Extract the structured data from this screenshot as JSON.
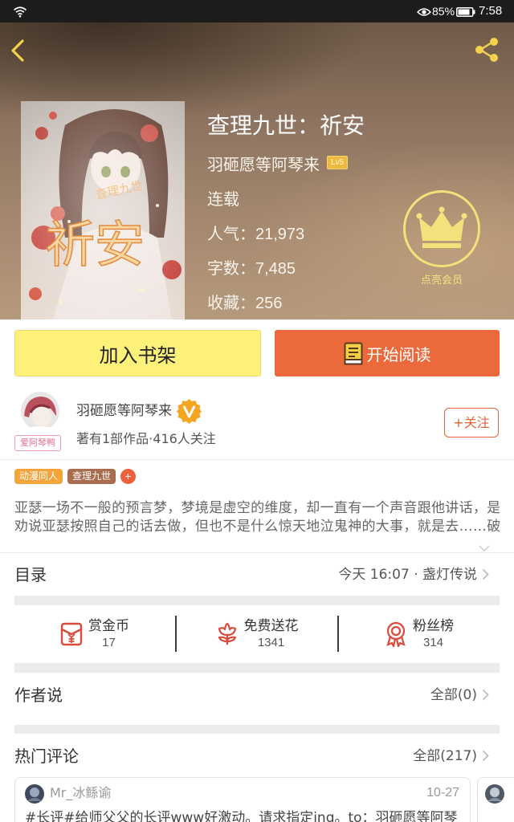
{
  "status_bar": {
    "battery": "85%",
    "battery_level": 0.85,
    "time": "7:58"
  },
  "header": {
    "back_icon": "chevron-left-icon",
    "share_icon": "share-icon"
  },
  "book": {
    "cover": {
      "series_art_text": "查理九世",
      "title_art_text": "祈安"
    },
    "title": "查理九世：祈安",
    "author": "羽砸愿等阿琴来",
    "author_level": "Lv5",
    "status": "连载",
    "stats": [
      {
        "label": "人气：",
        "value": "21,973"
      },
      {
        "label": "字数：",
        "value": "7,485"
      },
      {
        "label": "收藏：",
        "value": "256"
      }
    ]
  },
  "vip": {
    "icon": "crown-icon",
    "label": "点亮会员"
  },
  "actions": {
    "add_to_shelf": "加入书架",
    "start_reading": "开始阅读",
    "start_reading_icon": "book-icon"
  },
  "author_card": {
    "name": "羽砸愿等阿琴来",
    "badge_icon": "verified-v-badge-icon",
    "avatar_tag": "爱阿琴鸭",
    "summary": "著有1部作品·416人关注",
    "follow_label": "+关注"
  },
  "tags": [
    {
      "label": "动漫同人",
      "color": "#f4a43a"
    },
    {
      "label": "查理九世",
      "color": "#a86d4f"
    }
  ],
  "tag_add": {
    "label": "+",
    "color": "#ea613c"
  },
  "description": {
    "lines": [
      "亚瑟一场不一般的预言梦，梦境是虚空的维度，却一直有一个声音跟他讲话，是",
      "劝说亚瑟按照自己的话去做，但也不是什么惊天地泣鬼神的大事，就是去……破"
    ],
    "expand_icon": "chevron-down-icon"
  },
  "catalog": {
    "label": "目录",
    "latest": "今天 16:07 · 盏灯传说"
  },
  "rewards": [
    {
      "label": "赏金币",
      "value": "17",
      "icon": "red-envelope-icon"
    },
    {
      "label": "免费送花",
      "value": "1341",
      "icon": "flower-icon"
    },
    {
      "label": "粉丝榜",
      "value": "314",
      "icon": "award-ribbon-icon"
    }
  ],
  "author_says": {
    "label": "作者说",
    "all": "全部(0)"
  },
  "hot_comments": {
    "label": "热门评论",
    "all": "全部(217)",
    "items": [
      {
        "user": "Mr_冰鲧谕",
        "date": "10-27",
        "text": "#长评#给师父父的长评www好激动。请求指定ing。to：羽砸愿等阿琴"
      }
    ]
  },
  "colors": {
    "accent_orange": "#ea6a3c",
    "shelf_yellow": "#fdf17a",
    "vip_gold": "#f3e27c",
    "nav_icon_yellow": "#f3d24d",
    "icon_red": "#d94b3b"
  }
}
